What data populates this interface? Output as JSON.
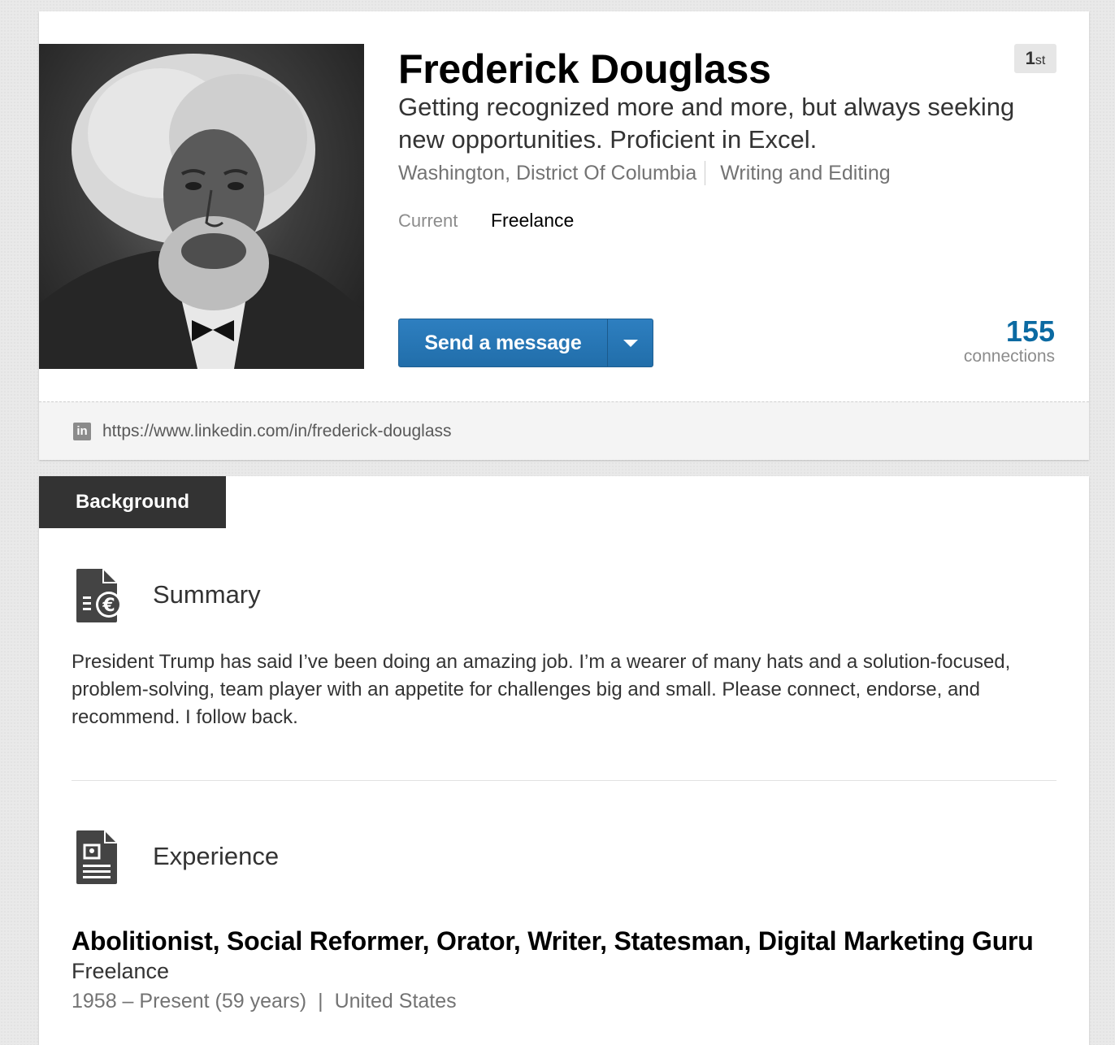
{
  "profile": {
    "name": "Frederick Douglass",
    "degree_num": "1",
    "degree_suffix": "st",
    "headline": "Getting recognized more and more, but always seeking new opportunities. Proficient in Excel.",
    "location": "Washington, District Of Columbia",
    "industry": "Writing and Editing",
    "current_label": "Current",
    "current_value": "Freelance",
    "message_button": "Send a message",
    "connections_count": "155",
    "connections_label": "connections",
    "profile_url": "https://www.linkedin.com/in/frederick-douglass",
    "linkedin_icon_glyph": "in"
  },
  "background": {
    "tab_label": "Background",
    "summary": {
      "title": "Summary",
      "icon": "summary-document-icon",
      "text": "President Trump has said I’ve been doing an amazing job. I’m a wearer of many hats and a solution-focused, problem-solving, team player with an appetite for challenges big and small. Please connect, endorse, and recommend. I follow back."
    },
    "experience": {
      "title": "Experience",
      "icon": "experience-document-icon",
      "job_title": "Abolitionist, Social Reformer, Orator, Writer, Statesman, Digital Marketing Guru",
      "company": "Freelance",
      "dates": "1958 – Present (59 years)",
      "location": "United States"
    }
  },
  "colors": {
    "accent_blue": "#0b6aa2",
    "button_blue": "#2e7fc0",
    "tab_dark": "#333333"
  }
}
